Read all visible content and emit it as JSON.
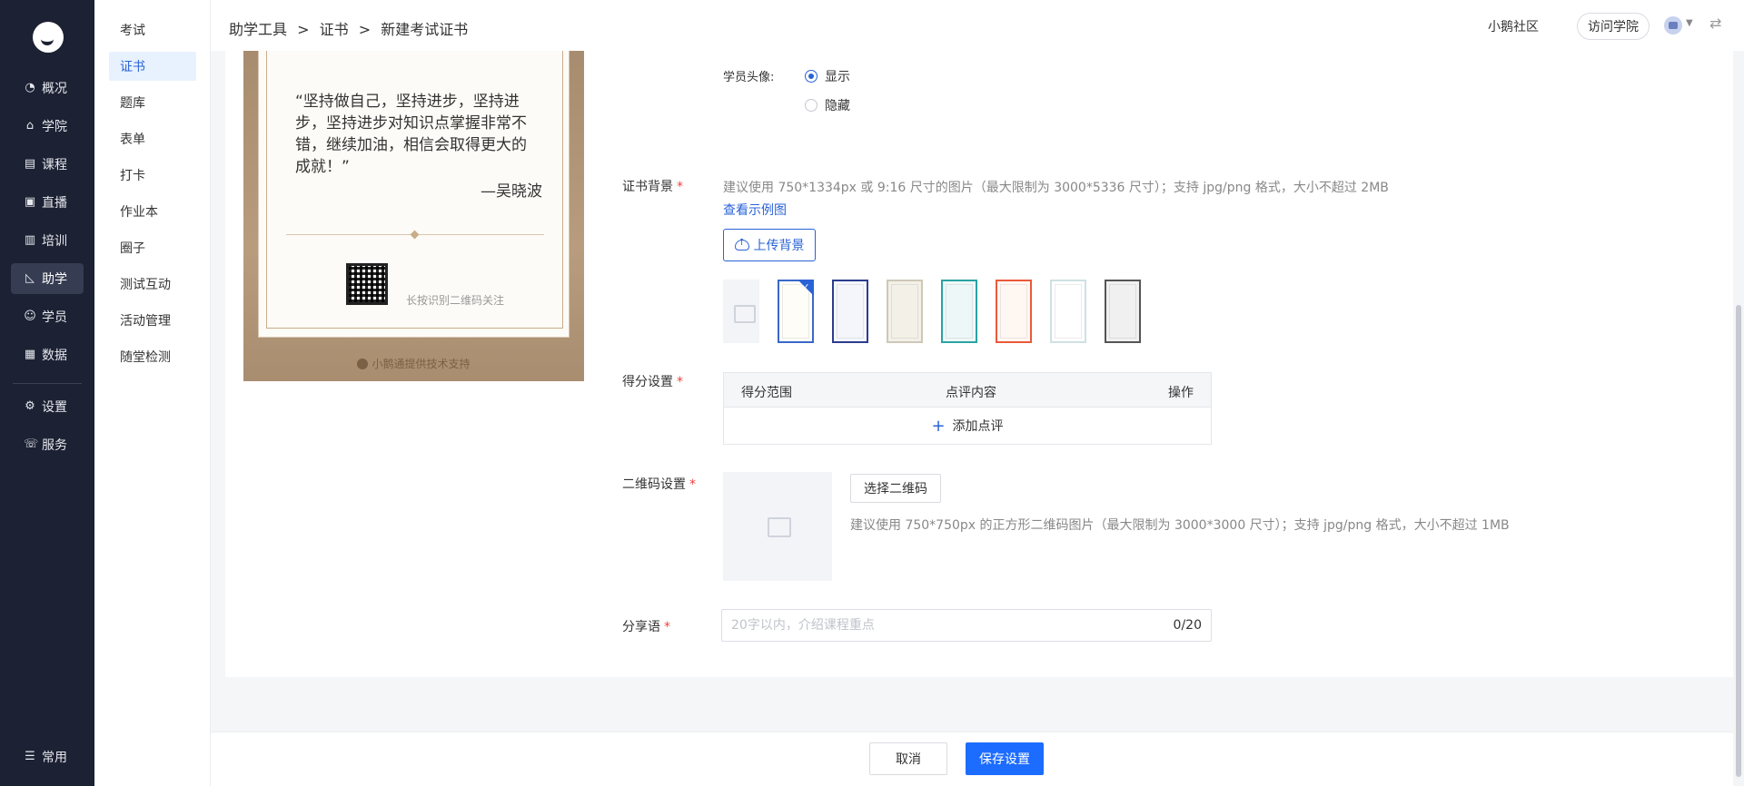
{
  "nav1": {
    "items": [
      {
        "label": "概况",
        "icon": "pie-chart-icon"
      },
      {
        "label": "学院",
        "icon": "building-icon"
      },
      {
        "label": "课程",
        "icon": "book-icon"
      },
      {
        "label": "直播",
        "icon": "live-icon"
      },
      {
        "label": "培训",
        "icon": "training-icon"
      },
      {
        "label": "助学",
        "icon": "ruler-icon"
      },
      {
        "label": "学员",
        "icon": "user-icon"
      },
      {
        "label": "数据",
        "icon": "data-icon"
      },
      {
        "label": "设置",
        "icon": "gear-icon"
      },
      {
        "label": "服务",
        "icon": "service-icon"
      }
    ],
    "bottom": {
      "label": "常用",
      "icon": "list-icon"
    }
  },
  "nav2": {
    "items": [
      "考试",
      "证书",
      "题库",
      "表单",
      "打卡",
      "作业本",
      "圈子",
      "测试互动",
      "活动管理",
      "随堂检测"
    ]
  },
  "header": {
    "breadcrumb": [
      "助学工具",
      ">",
      "证书",
      ">",
      "新建考试证书"
    ],
    "community": "小鹅社区",
    "visit": "访问学院"
  },
  "preview": {
    "quote": "“坚持做自己，坚持进步，坚持进步，坚持进步对知识点掌握非常不错，继续加油，相信会取得更大的成就！”",
    "author": "—吴晓波",
    "qr_tip": "长按识别二维码关注",
    "support": "小鹅通提供技术支持"
  },
  "form": {
    "avatar_label": "学员头像:",
    "avatar_show": "显示",
    "avatar_hide": "隐藏",
    "bg_label": "证书背景",
    "bg_hint": "建议使用 750*1334px 或 9:16 尺寸的图片（最大限制为 3000*5336 尺寸）；支持 jpg/png 格式，大小不超过 2MB",
    "bg_example": "查看示例图",
    "bg_upload": "上传背景",
    "bg_selected": "✓",
    "score_label": "得分设置",
    "score_cols": [
      "得分范围",
      "点评内容",
      "操作"
    ],
    "score_add": "添加点评",
    "qr_label": "二维码设置",
    "qr_select": "选择二维码",
    "qr_hint": "建议使用 750*750px 的正方形二维码图片（最大限制为 3000*3000 尺寸）；支持 jpg/png 格式，大小不超过 1MB",
    "share_label": "分享语",
    "share_placeholder": "20字以内，介绍课程重点",
    "share_value": "",
    "share_count": "0/20",
    "required_mark": "*"
  },
  "footer": {
    "cancel": "取消",
    "save": "保存设置"
  },
  "colors": {
    "accent": "#2a63d6",
    "primary_button": "#1c6cff",
    "sidebar_bg": "#1c2133",
    "required": "#f04040"
  }
}
